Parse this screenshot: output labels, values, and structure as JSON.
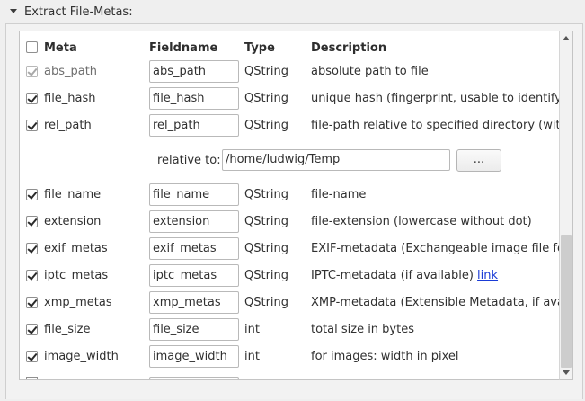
{
  "group": {
    "title": "Extract File-Metas:"
  },
  "table": {
    "headers": {
      "meta": "Meta",
      "fieldname": "Fieldname",
      "type": "Type",
      "description": "Description"
    },
    "relative_to": {
      "label": "relative to:",
      "value": "/home/ludwig/Temp",
      "button": "..."
    },
    "rows": [
      {
        "meta": "abs_path",
        "fieldname": "abs_path",
        "type": "QString",
        "description": "absolute path to file",
        "checked": true,
        "disabled": true
      },
      {
        "meta": "file_hash",
        "fieldname": "file_hash",
        "type": "QString",
        "description": "unique hash (fingerprint, usable to identify dupl",
        "checked": true
      },
      {
        "meta": "rel_path",
        "fieldname": "rel_path",
        "type": "QString",
        "description": "file-path relative to specified directory (without",
        "checked": true
      },
      {
        "meta": "file_name",
        "fieldname": "file_name",
        "type": "QString",
        "description": "file-name",
        "checked": true
      },
      {
        "meta": "extension",
        "fieldname": "extension",
        "type": "QString",
        "description": "file-extension (lowercase without dot)",
        "checked": true
      },
      {
        "meta": "exif_metas",
        "fieldname": "exif_metas",
        "type": "QString",
        "description": "EXIF-metadata (Exchangeable image file format",
        "checked": true
      },
      {
        "meta": "iptc_metas",
        "fieldname": "iptc_metas",
        "type": "QString",
        "description": "IPTC-metadata (if available) ",
        "link": "link",
        "checked": true
      },
      {
        "meta": "xmp_metas",
        "fieldname": "xmp_metas",
        "type": "QString",
        "description": "XMP-metadata (Extensible Metadata, if availabl",
        "checked": true
      },
      {
        "meta": "file_size",
        "fieldname": "file_size",
        "type": "int",
        "description": "total size in bytes",
        "checked": true
      },
      {
        "meta": "image_width",
        "fieldname": "image_width",
        "type": "int",
        "description": "for images: width in pixel",
        "checked": true
      }
    ]
  },
  "colors": {
    "link": "#1a3bd6",
    "panel_bg": "#ffffff",
    "window_bg": "#efefef"
  }
}
